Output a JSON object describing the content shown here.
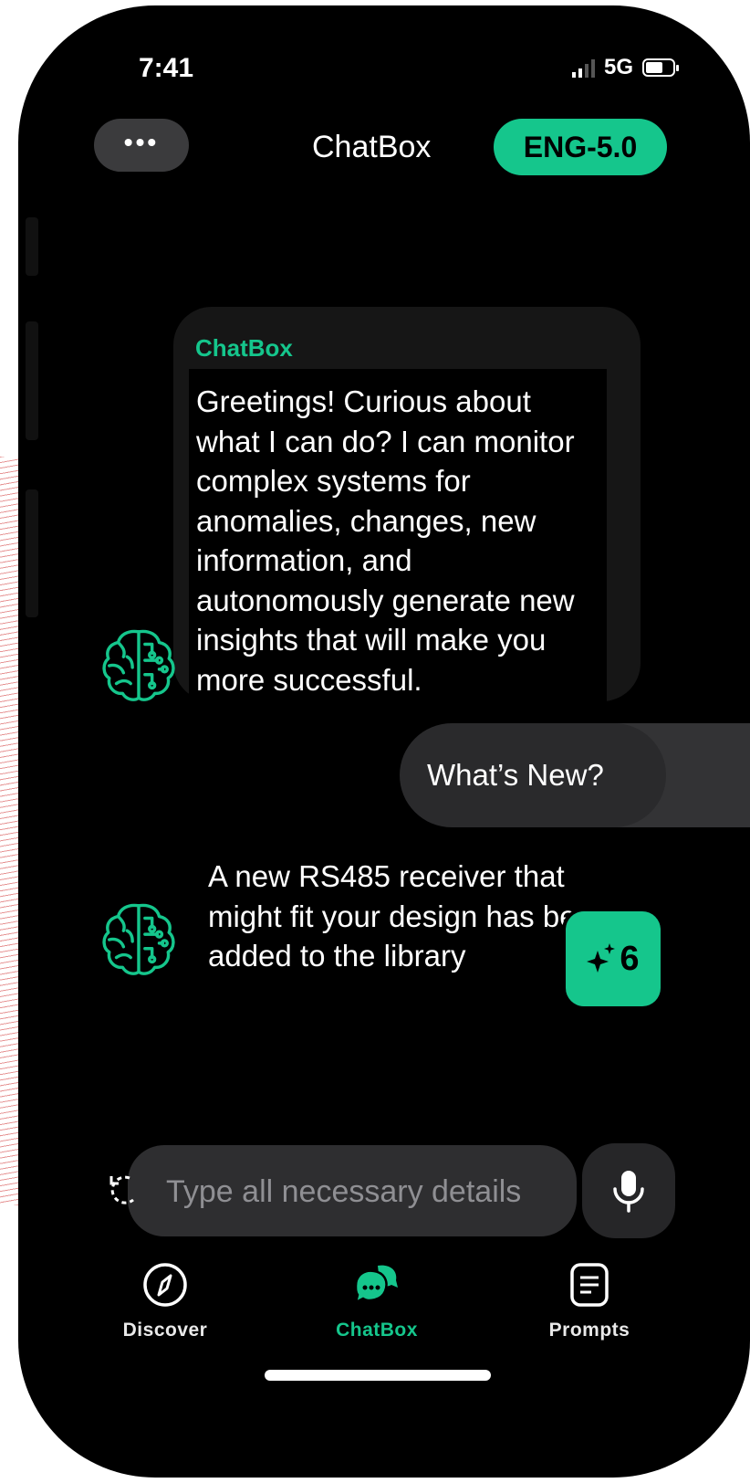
{
  "status": {
    "time": "7:41",
    "network": "5G"
  },
  "header": {
    "menu_label": "•••",
    "title": "ChatBox",
    "model_badge": "ENG-5.0"
  },
  "messages": [
    {
      "sender": "ChatBox",
      "text": "Greetings! Curious about what I can do? I can monitor complex systems for anomalies, changes, new information, and autonomously generate new insights that will make you more successful."
    },
    {
      "sender": "user",
      "text": "What’s New?"
    },
    {
      "sender": "bot",
      "text": "A new RS485 receiver that might fit your design has been added to the library"
    }
  ],
  "suggestion_badge": {
    "count": "6",
    "icon": "sparkle-icon"
  },
  "composer": {
    "placeholder": "Type all necessary details"
  },
  "nav": [
    {
      "label": "Discover",
      "icon": "compass-icon",
      "active": false
    },
    {
      "label": "ChatBox",
      "icon": "chat-bubbles-icon",
      "active": true
    },
    {
      "label": "Prompts",
      "icon": "document-icon",
      "active": false
    }
  ],
  "colors": {
    "accent": "#15c68c",
    "background": "#000000",
    "surface": "#2e2e30"
  }
}
